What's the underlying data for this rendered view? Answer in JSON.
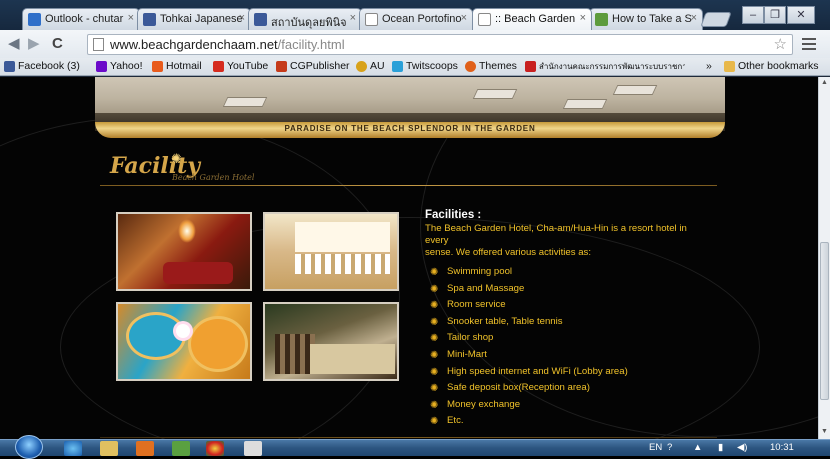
{
  "browser": {
    "tabs": [
      {
        "label": "Outlook - chutar",
        "icon": "outlook-icon",
        "color": "#2f6fc9"
      },
      {
        "label": "Tohkai Japanese",
        "icon": "facebook-icon",
        "color": "#3b5998"
      },
      {
        "label": "สถาบันดุลยพินิจ",
        "icon": "facebook-icon",
        "color": "#3b5998"
      },
      {
        "label": "Ocean Portofino",
        "icon": "page-icon",
        "color": "#ffffff"
      },
      {
        "label": ":: Beach Garden",
        "icon": "page-icon",
        "color": "#ffffff",
        "active": true
      },
      {
        "label": "How to Take a S",
        "icon": "wikihow-icon",
        "color": "#5d9b3c"
      }
    ],
    "url": {
      "host": "www.beachgardenchaam.net",
      "path": "/facility.html"
    },
    "bookmarks": [
      {
        "label": "Facebook (3)",
        "icon": "facebook-icon",
        "color": "#3b5998"
      },
      {
        "label": "Yahoo!",
        "icon": "yahoo-icon",
        "color": "#6b0ac9"
      },
      {
        "label": "Hotmail",
        "icon": "hotmail-icon",
        "color": "#e85b1c"
      },
      {
        "label": "YouTube",
        "icon": "youtube-icon",
        "color": "#d52b1e"
      },
      {
        "label": "CGPublisher",
        "icon": "cg-icon",
        "color": "#c53a1a"
      },
      {
        "label": "AU",
        "icon": "au-icon",
        "color": "#d8a21a"
      },
      {
        "label": "Twitscoops",
        "icon": "twitscoops-icon",
        "color": "#2aa0d8"
      },
      {
        "label": "Themes",
        "icon": "themes-icon",
        "color": "#e0601a"
      },
      {
        "label": "สำนักงานคณะกรรมการพัฒนาระบบราชการ",
        "icon": "thai-site-icon",
        "color": "#c82020"
      }
    ],
    "other_bookmarks": "Other bookmarks",
    "overflow": "»"
  },
  "site": {
    "banner_tagline": "PARADISE ON THE BEACH SPLENDOR IN THE GARDEN",
    "section_title": "Facility",
    "section_subtitle": "Beach Garden Hotel",
    "heading": "Facilities :",
    "intro_line1": "The Beach Garden Hotel, Cha-am/Hua-Hin is a resort hotel in every",
    "intro_line2": "sense. We offered various activities as:",
    "facilities": [
      "Swimming pool",
      "Spa and Massage",
      "Room service",
      "Snooker table, Table tennis",
      "Tailor shop",
      "Mini-Mart",
      "High speed internet and WiFi (Lobby area)",
      "Safe deposit box(Reception area)",
      "Money exchange",
      "Etc."
    ]
  },
  "taskbar": {
    "language": "EN",
    "clock": "10:31"
  },
  "colors": {
    "accent_gold": "#f0c22a",
    "page_bg": "#040404"
  }
}
